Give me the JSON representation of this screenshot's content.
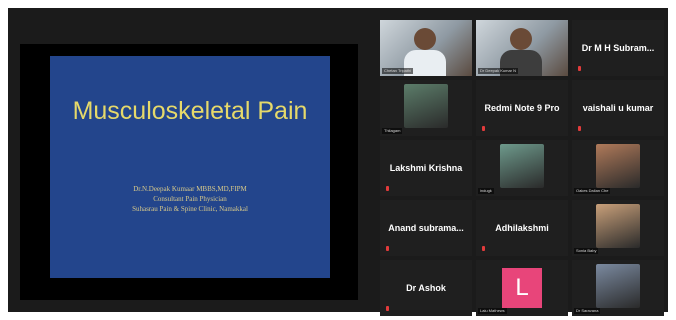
{
  "slide": {
    "title": "Musculoskeletal Pain",
    "lines": [
      "Dr.N.Deepak Kumaar MBBS,MD,FIPM",
      "Consultant Pain Physician",
      "Suhasrau Pain & Spine Clinic, Namakkal"
    ]
  },
  "participants": [
    {
      "name": "Chetan Tripathi",
      "kind": "video",
      "label": "Chetan Tripathi"
    },
    {
      "name": "Dr Deepak",
      "kind": "video",
      "label": "Dr Deepak Kumar N",
      "active": true
    },
    {
      "name": "Dr M H Subram...",
      "kind": "name"
    },
    {
      "name": "Thilagam",
      "kind": "photo",
      "label": "Thilagam"
    },
    {
      "name": "Redmi Note 9 Pro",
      "kind": "name"
    },
    {
      "name": "vaishali u kumar",
      "kind": "name"
    },
    {
      "name": "Lakshmi Krishna",
      "kind": "name"
    },
    {
      "name": "Indugk",
      "kind": "photo",
      "label": "indugk"
    },
    {
      "name": "Oakes Dalian Che",
      "kind": "photo",
      "label": "Oakes Dalian Che"
    },
    {
      "name": "Anand subrama...",
      "kind": "name"
    },
    {
      "name": "Adhilakshmi",
      "kind": "name"
    },
    {
      "name": "Sonia Baby",
      "kind": "photo",
      "label": "Sonia Baby"
    },
    {
      "name": "Dr Ashok",
      "kind": "name"
    },
    {
      "name": "Lalu Mathews",
      "kind": "avatar",
      "initial": "L",
      "label": "Lalu Mathews"
    },
    {
      "name": "Dr Saravana",
      "kind": "photo",
      "label": "Dr Saravana"
    }
  ],
  "colors": {
    "slide_bg": "#23458c",
    "title": "#e6d96a",
    "active_border": "#c9d62e",
    "mic_muted": "#e23b3b",
    "avatar": "#e8457a"
  }
}
